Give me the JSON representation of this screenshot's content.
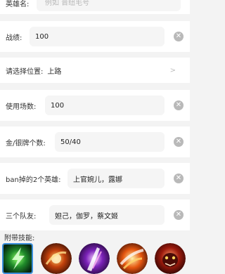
{
  "form": {
    "hero_name": {
      "label": "英雄名:",
      "placeholder": "例如 晋纽毛号"
    },
    "record": {
      "label": "战绩:",
      "value": "100"
    },
    "position": {
      "label": "请选择位置:",
      "value": "上路"
    },
    "matches": {
      "label": "使用场数:",
      "value": "100"
    },
    "medals": {
      "label": "金/银牌个数:",
      "value": "50/40"
    },
    "banned": {
      "label": "ban掉的2个英雄:",
      "value": "上官婉儿，露娜"
    },
    "teammates": {
      "label": "三个队友:",
      "value": "妲己，伽罗，蔡文姬"
    }
  },
  "skills": {
    "label": "附带技能:",
    "items": [
      {
        "icon": "skill-green-bolt-icon",
        "selected": true
      },
      {
        "icon": "skill-fire-orb-icon",
        "selected": false
      },
      {
        "icon": "skill-purple-slash-icon",
        "selected": false
      },
      {
        "icon": "skill-fire-dash-icon",
        "selected": false
      },
      {
        "icon": "skill-red-beast-icon",
        "selected": false
      }
    ]
  },
  "colors": {
    "background": "#f3f3f3",
    "field": "#f5f5f5",
    "selected_border": "#3b8edb",
    "clear_button": "#b9b9b9"
  }
}
